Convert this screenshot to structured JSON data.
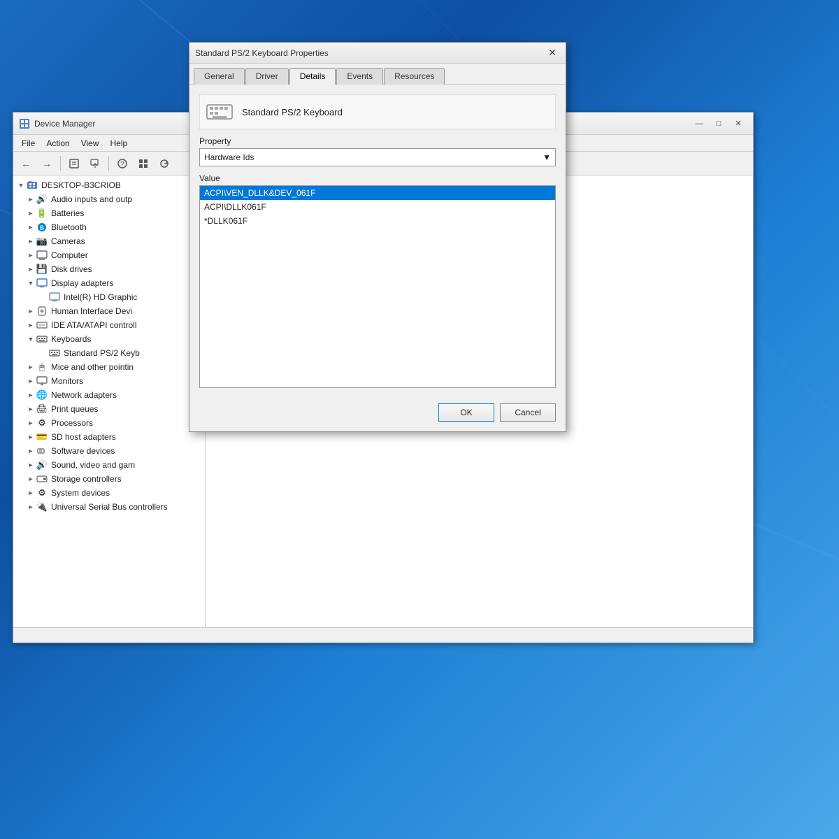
{
  "desktop": {
    "background": "Windows 10 blue gradient"
  },
  "device_manager_window": {
    "title": "Device Manager",
    "menu": {
      "items": [
        "File",
        "Action",
        "View",
        "Help"
      ]
    },
    "toolbar": {
      "buttons": [
        "back",
        "forward",
        "properties",
        "update-driver",
        "help",
        "display-all",
        "scan-changes"
      ]
    },
    "tree": {
      "root": "DESKTOP-B3CRIOB",
      "items": [
        {
          "label": "Audio inputs and outp",
          "level": 1,
          "icon": "🔊",
          "expanded": false
        },
        {
          "label": "Batteries",
          "level": 1,
          "icon": "🔋",
          "expanded": false
        },
        {
          "label": "Bluetooth",
          "level": 1,
          "icon": "🔵",
          "expanded": false
        },
        {
          "label": "Cameras",
          "level": 1,
          "icon": "📷",
          "expanded": false
        },
        {
          "label": "Computer",
          "level": 1,
          "icon": "💻",
          "expanded": false
        },
        {
          "label": "Disk drives",
          "level": 1,
          "icon": "💾",
          "expanded": false
        },
        {
          "label": "Display adapters",
          "level": 1,
          "icon": "🖥",
          "expanded": true
        },
        {
          "label": "Intel(R) HD Graphic",
          "level": 2,
          "icon": "🖥",
          "expanded": false
        },
        {
          "label": "Human Interface Devi",
          "level": 1,
          "icon": "🖮",
          "expanded": false
        },
        {
          "label": "IDE ATA/ATAPI controll",
          "level": 1,
          "icon": "💽",
          "expanded": false
        },
        {
          "label": "Keyboards",
          "level": 1,
          "icon": "⌨",
          "expanded": true
        },
        {
          "label": "Standard PS/2 Keyb",
          "level": 2,
          "icon": "⌨",
          "expanded": false,
          "selected": false
        },
        {
          "label": "Mice and other pointin",
          "level": 1,
          "icon": "🖱",
          "expanded": false
        },
        {
          "label": "Monitors",
          "level": 1,
          "icon": "🖥",
          "expanded": false
        },
        {
          "label": "Network adapters",
          "level": 1,
          "icon": "🌐",
          "expanded": false
        },
        {
          "label": "Print queues",
          "level": 1,
          "icon": "🖨",
          "expanded": false
        },
        {
          "label": "Processors",
          "level": 1,
          "icon": "⚙",
          "expanded": false
        },
        {
          "label": "SD host adapters",
          "level": 1,
          "icon": "💳",
          "expanded": false
        },
        {
          "label": "Software devices",
          "level": 1,
          "icon": "📱",
          "expanded": false
        },
        {
          "label": "Sound, video and gam",
          "level": 1,
          "icon": "🔊",
          "expanded": false
        },
        {
          "label": "Storage controllers",
          "level": 1,
          "icon": "💽",
          "expanded": false
        },
        {
          "label": "System devices",
          "level": 1,
          "icon": "⚙",
          "expanded": false
        },
        {
          "label": "Universal Serial Bus controllers",
          "level": 1,
          "icon": "🔌",
          "expanded": false
        }
      ]
    }
  },
  "properties_dialog": {
    "title": "Standard PS/2 Keyboard Properties",
    "tabs": [
      "General",
      "Driver",
      "Details",
      "Events",
      "Resources"
    ],
    "active_tab": "Details",
    "device_name": "Standard PS/2 Keyboard",
    "property_label": "Property",
    "property_value": "Hardware Ids",
    "value_label": "Value",
    "values": [
      {
        "text": "ACPI\\VEN_DLLK&DEV_061F",
        "selected": true
      },
      {
        "text": "ACPI\\DLLK061F",
        "selected": false
      },
      {
        "text": "*DLLK061F",
        "selected": false
      }
    ],
    "buttons": {
      "ok": "OK",
      "cancel": "Cancel"
    }
  }
}
